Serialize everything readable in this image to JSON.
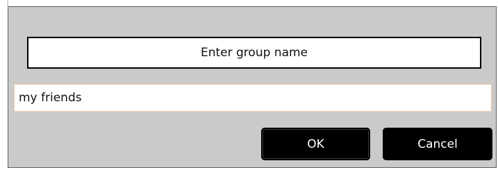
{
  "dialog": {
    "header_text": "Enter group name",
    "input": {
      "value": "my friends",
      "placeholder": ""
    },
    "buttons": {
      "ok_label": "OK",
      "cancel_label": "Cancel"
    },
    "colors": {
      "dialog_background": "#cacaca",
      "button_background": "#000000",
      "button_text": "#ffffff",
      "input_border": "#e9c9a6"
    }
  }
}
